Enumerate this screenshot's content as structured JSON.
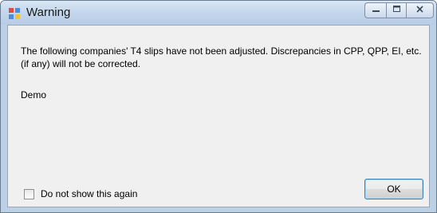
{
  "window": {
    "title": "Warning",
    "controls": {
      "minimize_icon": "minimize-icon",
      "maximize_icon": "maximize-icon",
      "close_icon": "close-icon"
    }
  },
  "dialog": {
    "message": "The following companies' T4 slips have not been adjusted. Discrepancies in CPP, QPP, EI, etc. (if any) will not be corrected.",
    "company": "Demo",
    "checkbox_label": "Do not show this again",
    "checkbox_checked": false,
    "ok_label": "OK"
  },
  "colors": {
    "titlebar": "#c3d6ec",
    "client_background": "#f0f0f0",
    "button_focus_border": "#3c7fb1"
  }
}
